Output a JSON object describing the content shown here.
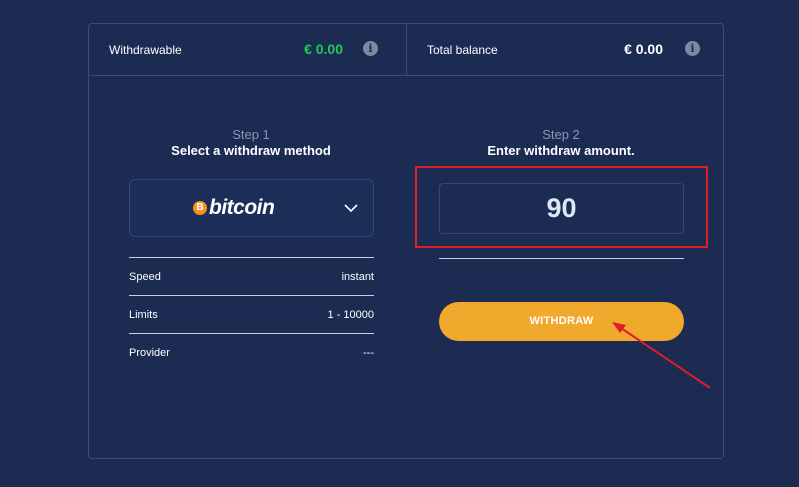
{
  "header": {
    "withdrawable_label": "Withdrawable",
    "withdrawable_value": "€ 0.00",
    "total_label": "Total balance",
    "total_value": "€ 0.00",
    "info_glyph": "i"
  },
  "step1": {
    "label": "Step 1",
    "title": "Select a withdraw method",
    "method": {
      "coin_glyph": "B",
      "name": "bitcoin",
      "icon": "bitcoin-logo"
    }
  },
  "details": [
    {
      "key": "Speed",
      "value": "instant"
    },
    {
      "key": "Limits",
      "value": "1 - 10000"
    },
    {
      "key": "Provider",
      "value": "---"
    }
  ],
  "step2": {
    "label": "Step 2",
    "title": "Enter withdraw amount.",
    "amount": "90"
  },
  "withdraw_button": "WITHDRAW",
  "colors": {
    "background": "#1b2b52",
    "accent_button": "#f0a92c",
    "positive_amount": "#1ecb52",
    "annotation_red": "#e01d2b"
  }
}
